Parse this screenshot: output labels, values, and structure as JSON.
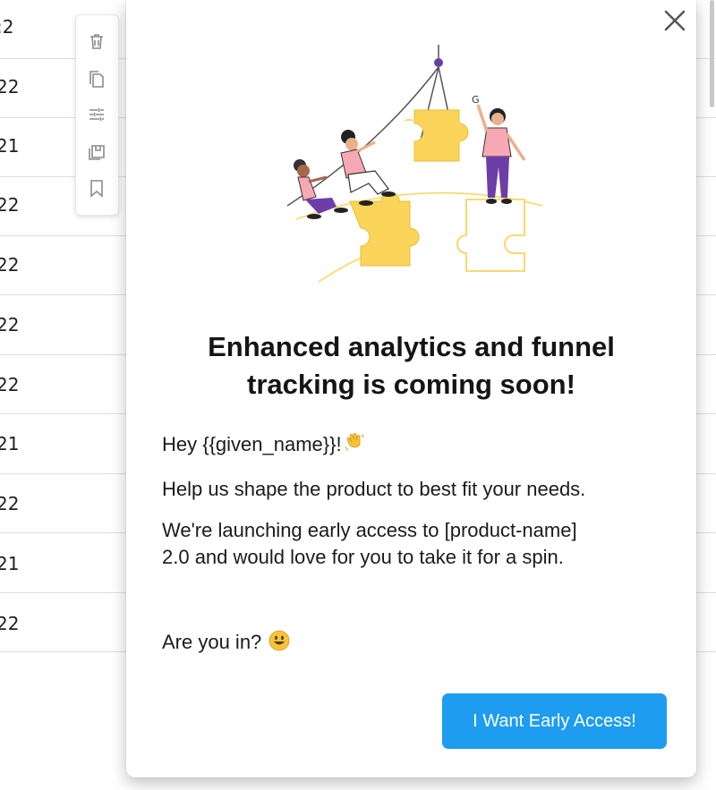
{
  "background_table": {
    "rows": [
      ":2",
      "22",
      "21",
      "22",
      "22",
      "22",
      "22",
      "21",
      "22",
      "21",
      "22"
    ]
  },
  "toolbar": {
    "icons": [
      "trash-icon",
      "copy-icon",
      "sliders-icon",
      "save-icon",
      "bookmark-icon"
    ]
  },
  "modal": {
    "title_line1": "Enhanced analytics and funnel",
    "title_line2": "tracking is coming soon!",
    "greeting": "Hey {{given_name}}!",
    "greeting_emoji": "waving-hand",
    "line1": "Help us shape the product to best fit your needs.",
    "line2a": "We're launching early access to [product-name]",
    "line2b": "2.0 and would love for you to take it for a spin.",
    "question": "Are you in?",
    "question_emoji": "smiley",
    "cta_label": "I Want Early Access!"
  },
  "colors": {
    "accent": "#1e9cf0",
    "puzzle_yellow": "#fbd55a",
    "figure_purple": "#6c3fa8",
    "figure_pink": "#f6a9b4"
  }
}
